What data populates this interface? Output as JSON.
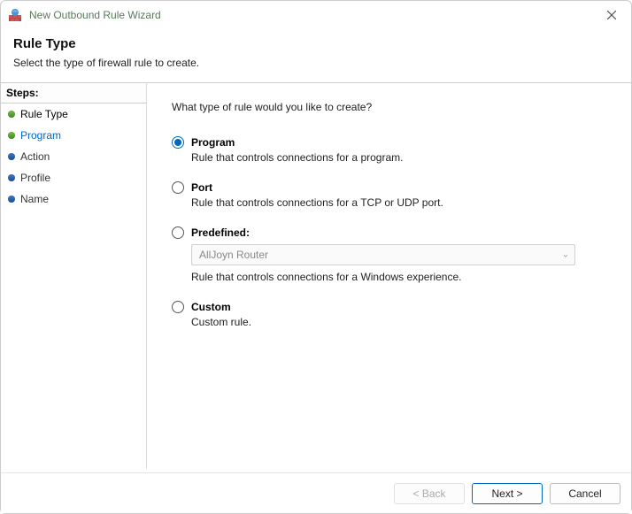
{
  "window": {
    "title": "New Outbound Rule Wizard",
    "close_tooltip": "Close"
  },
  "header": {
    "title": "Rule Type",
    "subtitle": "Select the type of firewall rule to create."
  },
  "sidebar": {
    "header": "Steps:",
    "items": [
      {
        "label": "Rule Type",
        "state": "current"
      },
      {
        "label": "Program",
        "state": "next"
      },
      {
        "label": "Action",
        "state": "future"
      },
      {
        "label": "Profile",
        "state": "future"
      },
      {
        "label": "Name",
        "state": "future"
      }
    ]
  },
  "main": {
    "prompt": "What type of rule would you like to create?",
    "options": {
      "program": {
        "title": "Program",
        "desc": "Rule that controls connections for a program.",
        "checked": true
      },
      "port": {
        "title": "Port",
        "desc": "Rule that controls connections for a TCP or UDP port.",
        "checked": false
      },
      "predefined": {
        "title": "Predefined:",
        "desc": "Rule that controls connections for a Windows experience.",
        "checked": false,
        "selected_value": "AllJoyn Router",
        "enabled": false
      },
      "custom": {
        "title": "Custom",
        "desc": "Custom rule.",
        "checked": false
      }
    }
  },
  "footer": {
    "back": "< Back",
    "back_enabled": false,
    "next": "Next >",
    "cancel": "Cancel"
  }
}
